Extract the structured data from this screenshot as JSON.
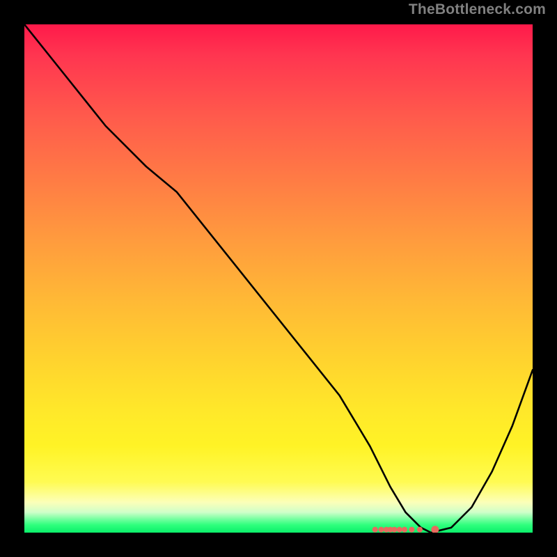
{
  "watermark": "TheBottleneck.com",
  "chart_data": {
    "type": "line",
    "title": "",
    "xlabel": "",
    "ylabel": "",
    "xlim": [
      0,
      100
    ],
    "ylim": [
      0,
      100
    ],
    "grid": false,
    "curve": {
      "name": "bottleneck-curve",
      "x": [
        0,
        8,
        16,
        24,
        30,
        38,
        46,
        54,
        62,
        68,
        72,
        75,
        78,
        80,
        84,
        88,
        92,
        96,
        100
      ],
      "y": [
        100,
        90,
        80,
        72,
        67,
        57,
        47,
        37,
        27,
        17,
        9,
        4,
        1,
        0,
        1,
        5,
        12,
        21,
        32
      ]
    },
    "markers": {
      "name": "bottom-dots",
      "x": [
        69.0,
        70.2,
        71.2,
        72.0,
        72.8,
        73.8,
        74.8,
        76.2,
        77.8,
        80.8
      ],
      "y": [
        0.6,
        0.6,
        0.6,
        0.6,
        0.6,
        0.6,
        0.6,
        0.6,
        0.6,
        0.6
      ]
    },
    "colors": {
      "curve": "#000000",
      "markers": "#e86a5e",
      "gradient_top": "#ff1a4a",
      "gradient_mid": "#ffd32e",
      "gradient_bottom": "#0aef6a"
    }
  }
}
